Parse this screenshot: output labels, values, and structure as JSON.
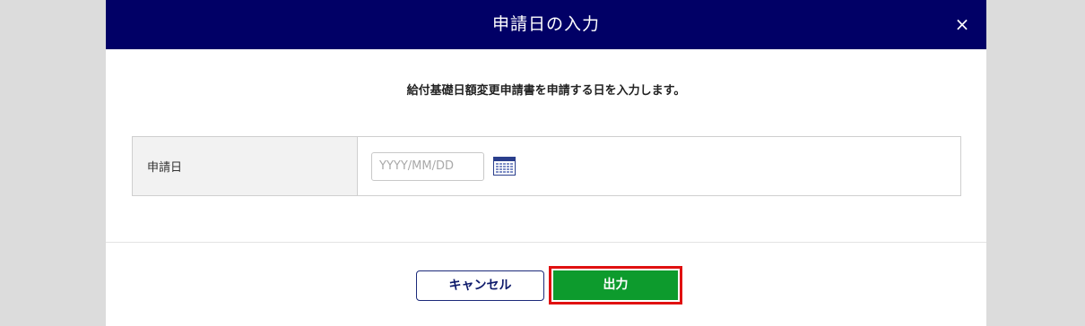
{
  "dialog": {
    "title": "申請日の入力",
    "close_label": "×"
  },
  "instruction": "給付基礎日額変更申請書を申請する日を入力します。",
  "form": {
    "field_label": "申請日",
    "date_value": "",
    "date_placeholder": "YYYY/MM/DD",
    "calendar_icon": "calendar-icon"
  },
  "buttons": {
    "cancel_label": "キャンセル",
    "submit_label": "出力"
  },
  "colors": {
    "header_bg": "#010066",
    "submit_bg": "#0d9b2d",
    "highlight_border": "#e01010"
  }
}
